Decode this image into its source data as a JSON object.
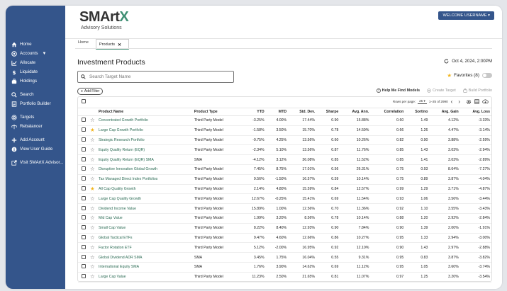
{
  "sidebar": {
    "items": [
      {
        "label": "Home",
        "icon": "home-icon"
      },
      {
        "label": "Accounts",
        "icon": "accounts-icon"
      },
      {
        "label": "Allocate",
        "icon": "allocate-icon"
      },
      {
        "label": "Liquidate",
        "icon": "liquidate-icon"
      },
      {
        "label": "Holdings",
        "icon": "holdings-icon"
      },
      {
        "label": "Search",
        "icon": "search-icon"
      },
      {
        "label": "Portfolio Builder",
        "icon": "portfolio-builder-icon"
      },
      {
        "label": "Targets",
        "icon": "targets-icon"
      },
      {
        "label": "Rebalancer",
        "icon": "rebalancer-icon"
      },
      {
        "label": "Add Account",
        "icon": "add-icon"
      },
      {
        "label": "View User Guide",
        "icon": "info-icon"
      },
      {
        "label": "Visit SMArtX Advisor...",
        "icon": "external-link-icon"
      }
    ]
  },
  "header": {
    "logo_main": "SMArt",
    "logo_x": "X",
    "logo_sub": "Advisory Solutions",
    "welcome": "WELCOME USERNAME ▾"
  },
  "tabs": [
    {
      "label": "Home"
    },
    {
      "label": "Products",
      "close": "✕"
    }
  ],
  "page": {
    "title": "Investment Products",
    "datetime": "Oct 4, 2024, 2:00PM",
    "search_placeholder": "Search Target Name",
    "favorites": "Favorites (8)",
    "add_filter": "Add Filter",
    "help": "Help Me Find Models",
    "create_target": "Create Target",
    "build_portfolio": "Build Portfolio"
  },
  "pager": {
    "rows_label": "Rows per page:",
    "rows_value": "25",
    "range": "1–25 of 2990"
  },
  "colors": {
    "sidebar": "#34558b",
    "accent": "#3f8f73",
    "star": "#f2b51d"
  },
  "table": {
    "columns": [
      "Product Name",
      "Product Type",
      "YTD",
      "MTD",
      "Std. Dev.",
      "Sharpe",
      "Avg. Ann.",
      "Correlation",
      "Sortino",
      "Avg. Gain",
      "Avg. Loss"
    ],
    "rows": [
      {
        "fav": false,
        "cells": [
          "Concentrated Growth Portfolio",
          "Third Party Model",
          "-3.25%",
          "4.00%",
          "17.44%",
          "0.90",
          "15.88%",
          "0.60",
          "1.49",
          "4.12%",
          "-3.33%"
        ]
      },
      {
        "fav": true,
        "cells": [
          "Large Cap Growth Portfolio",
          "Third Party Model",
          "-1.58%",
          "3.50%",
          "15.70%",
          "0.78",
          "14.59%",
          "0.66",
          "1.26",
          "4.47%",
          "-3.14%"
        ]
      },
      {
        "fav": false,
        "cells": [
          "Strategic Research Portfolio",
          "Third Party Model",
          "-0.75%",
          "4.25%",
          "13.56%",
          "0.60",
          "10.26%",
          "0.82",
          "0.90",
          "3.88%",
          "-2.59%"
        ]
      },
      {
        "fav": false,
        "cells": [
          "Equity Quality Return (EQR)",
          "Third Party Model",
          "-2.34%",
          "5.10%",
          "13.56%",
          "0.87",
          "11.76%",
          "0.85",
          "1.43",
          "3.03%",
          "-2.94%"
        ]
      },
      {
        "fav": false,
        "cells": [
          "Equity Quality Return (EQR) SMA",
          "SMA",
          "-4.12%",
          "3.12%",
          "36.08%",
          "0.85",
          "11.52%",
          "0.85",
          "1.41",
          "3.03%",
          "-2.89%"
        ]
      },
      {
        "fav": false,
        "cells": [
          "Disruptive Innovation Global Growth",
          "Third Party Model",
          "7.45%",
          "8.75%",
          "17.01%",
          "0.56",
          "26.31%",
          "0.75",
          "0.93",
          "8.64%",
          "-7.27%"
        ]
      },
      {
        "fav": false,
        "cells": [
          "Tax Managed Direct Index Portfolios",
          "Third Party Model",
          "9.56%",
          "-1.50%",
          "16.57%",
          "0.59",
          "10.14%",
          "0.75",
          "0.89",
          "3.87%",
          "-4.04%"
        ]
      },
      {
        "fav": true,
        "cells": [
          "All Cap Quality Growth",
          "Third Party Model",
          "2.14%",
          "4.80%",
          "15.59%",
          "0.84",
          "12.57%",
          "0.99",
          "1.29",
          "3.71%",
          "-4.87%"
        ]
      },
      {
        "fav": false,
        "cells": [
          "Large Cap Quality Growth",
          "Third Party Model",
          "12.67%",
          "-0.25%",
          "15.41%",
          "0.69",
          "11.54%",
          "0.93",
          "1.06",
          "3.56%",
          "-3.44%"
        ]
      },
      {
        "fav": false,
        "cells": [
          "Dividend Income Value",
          "Third Party Model",
          "15.89%",
          "1.00%",
          "12.56%",
          "0.70",
          "11.36%",
          "0.92",
          "1.10",
          "3.55%",
          "-3.43%"
        ]
      },
      {
        "fav": false,
        "cells": [
          "Mid Cap Value",
          "Third Party Model",
          "1.99%",
          "3.20%",
          "8.56%",
          "0.78",
          "10.14%",
          "0.88",
          "1.20",
          "2.92%",
          "-2.84%"
        ]
      },
      {
        "fav": false,
        "cells": [
          "Small Cap Value",
          "Third Party Model",
          "8.22%",
          "8.40%",
          "12.93%",
          "0.90",
          "7.84%",
          "0.90",
          "1.39",
          "2.00%",
          "-1.91%"
        ]
      },
      {
        "fav": false,
        "cells": [
          "Global Tactical ETFs",
          "Third Party Model",
          "9.47%",
          "4.60%",
          "12.66%",
          "0.86",
          "10.27%",
          "0.95",
          "1.33",
          "2.94%",
          "-3.00%"
        ]
      },
      {
        "fav": false,
        "cells": [
          "Factor Rotation ETF",
          "Third Party Model",
          "5.12%",
          "-2.00%",
          "16.95%",
          "0.92",
          "12.10%",
          "0.90",
          "1.43",
          "2.97%",
          "-2.88%"
        ]
      },
      {
        "fav": false,
        "cells": [
          "Global Dividend ADR SMA",
          "SMA",
          "3.45%",
          "1.75%",
          "16.04%",
          "0.55",
          "9.31%",
          "0.95",
          "0.83",
          "3.87%",
          "-3.82%"
        ]
      },
      {
        "fav": false,
        "cells": [
          "International Equity SMA",
          "SMA",
          "1.76%",
          "3.90%",
          "14.62%",
          "0.69",
          "11.12%",
          "0.95",
          "1.05",
          "3.60%",
          "-3.74%"
        ]
      },
      {
        "fav": false,
        "cells": [
          "Large Cap Value",
          "Third Party Model",
          "11.23%",
          "2.50%",
          "21.65%",
          "0.81",
          "11.07%",
          "0.97",
          "1.25",
          "3.20%",
          "-3.54%"
        ]
      }
    ]
  }
}
